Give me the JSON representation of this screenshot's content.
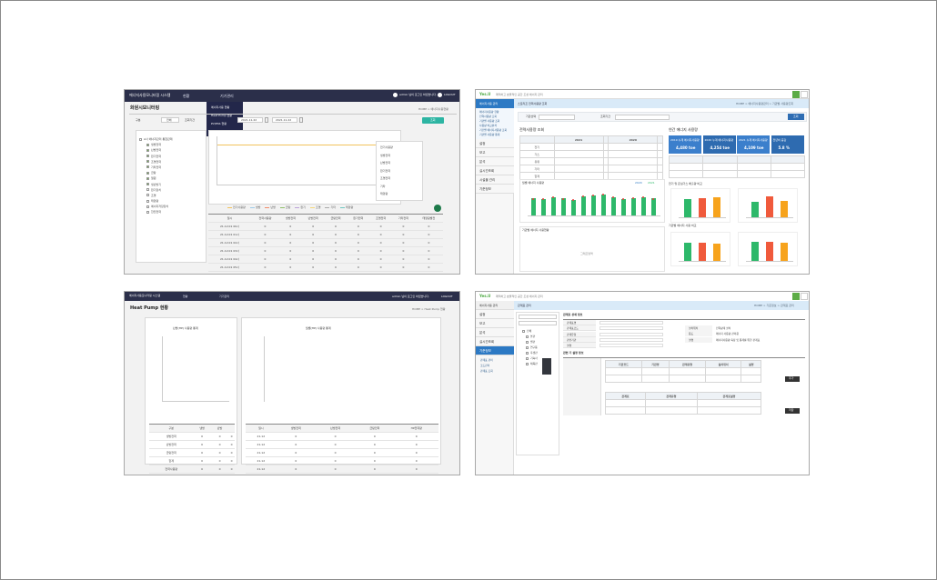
{
  "s1": {
    "app_title": "에너지사용모니터링 시스템",
    "nav": [
      "현황",
      "기기관리"
    ],
    "user": "admin 님이 로그인 하셨습니다.",
    "logout": "LOGOUT",
    "dropdown": [
      "에너지사용 현황",
      "Heat Pump 현황",
      "PV/ESS 현황",
      "에너지사용량 조회"
    ],
    "page_title": "화원시모니터링",
    "breadcrumb": "HOME > 에너지사용현황",
    "filter_label1": "구분",
    "filter_value1": "전체",
    "filter_label2": "조회기간",
    "date_from": "2021.11.22",
    "date_to": "2021.11.22",
    "search_btn": "조회",
    "tree": [
      "A사 에너지관리 통합관제",
      "냉방전력",
      "난방전력",
      "환기전력",
      "조명전력",
      "기타전력",
      "급탕",
      "열원",
      "냉난방기",
      "환기장치",
      "조명",
      "태양광",
      "에너지저장장치",
      "한전전력"
    ],
    "legend": [
      "전기사용량",
      "냉방",
      "난방",
      "급탕",
      "환기",
      "조명",
      "기타",
      "태양광"
    ],
    "side_list": [
      "전기사용량",
      "냉방전력",
      "난방전력",
      "환기전력",
      "조명전력",
      "기타",
      "태양광"
    ],
    "table_headers": [
      "일시",
      "전력사용량",
      "냉방전력",
      "난방전력",
      "급탕전력",
      "환기전력",
      "조명전력",
      "기타전력",
      "태양광발전"
    ],
    "table_rows": [
      [
        "21.12.01 00시",
        "0",
        "0",
        "0",
        "0",
        "0",
        "0",
        "0",
        "0"
      ],
      [
        "21.12.01 01시",
        "0",
        "0",
        "0",
        "0",
        "0",
        "0",
        "0",
        "0"
      ],
      [
        "21.12.01 02시",
        "0",
        "0",
        "0",
        "0",
        "0",
        "0",
        "0",
        "0"
      ],
      [
        "21.12.01 03시",
        "0",
        "0",
        "0",
        "0",
        "0",
        "0",
        "0",
        "0"
      ],
      [
        "21.12.01 04시",
        "0",
        "0",
        "0",
        "0",
        "0",
        "0",
        "0",
        "0"
      ],
      [
        "21.12.01 05시",
        "0",
        "0",
        "0",
        "0",
        "0",
        "0",
        "0",
        "0"
      ]
    ]
  },
  "s2": {
    "logo": "Yes.U",
    "logo_sub": "쾌적하고 효율적인 공간 조성 에너지 관리",
    "page_title": "스토리프 전력사용량 조회",
    "breadcrumb": "HOME > 에너지사용량관리 > 기관별 사용량조회",
    "sidebar_head": "에너지사용 관리",
    "sidebar_sub": [
      "에너지사용량 현황",
      "전력사용량 조회",
      "기관별 사용량 조회",
      "사용량 비교분석",
      "기간별 에너지사용량 조회",
      "기관별 사용량 통계"
    ],
    "nav": [
      "설정",
      "보고",
      "분석",
      "실시간조회",
      "시설물 관리",
      "기준정보"
    ],
    "filter1": "기관선택",
    "filter2": "조회기간",
    "search_btn": "조회",
    "left_title": "전력사용량 조회",
    "right_title": "연간 에너지 사용량",
    "blue_boxes": [
      {
        "label": "2019 누계 에너지사용량",
        "value": "4,480 toe"
      },
      {
        "label": "2020 누계 에너지사용량",
        "value": "4,254 toe"
      },
      {
        "label": "2021 누계 에너지사용량",
        "value": "4,109 toe"
      },
      {
        "label": "전년비 증감",
        "value": "5.8 %"
      }
    ],
    "chart1_title": "월별 에너지 사용량",
    "chart1_legend": [
      "2020",
      "2021"
    ],
    "chart1_values": [
      62,
      60,
      66,
      62,
      58,
      70,
      74,
      78,
      66,
      60,
      64,
      68,
      62
    ],
    "chart2_title": "기관별 에너지 사용현황",
    "chart2_placeholder": "그래프영역",
    "mini1_title": "전기 및 온실가스 배출량 비교",
    "mini2_title": "기관별 에너지 사용 비교",
    "mini_values": [
      [
        70,
        75,
        78
      ],
      [
        60,
        82,
        64
      ],
      [
        72,
        70,
        68
      ],
      [
        74,
        76,
        72
      ]
    ],
    "mini_colors": [
      "#2db86a",
      "#f05a3c",
      "#f7a31c"
    ]
  },
  "s3": {
    "app_title": "에너지사용모니터링 시스템",
    "nav": [
      "현황",
      "기기관리"
    ],
    "user": "admin 님이 로그인 하셨습니다.",
    "logout": "LOGOUT",
    "page_title": "Heat Pump 현황",
    "breadcrumb": "HOME > Heat Pump 현황",
    "left_chart_title": "난방(HP) 사용량 통계",
    "right_chart_title": "월별(HP) 사용량 통계",
    "left_table_headers": [
      "구분",
      "냉방",
      "난방"
    ],
    "left_table_rows": [
      [
        "냉방전력",
        "0",
        "0",
        "0"
      ],
      [
        "난방전력",
        "0",
        "0",
        "0"
      ],
      [
        "급탕전력",
        "0",
        "0",
        "0"
      ],
      [
        "합계",
        "0",
        "0",
        "0"
      ],
      [
        "전력사용량",
        "0",
        "0",
        "0"
      ]
    ],
    "right_table_headers": [
      "일시",
      "냉방전력",
      "난방전력",
      "급탕전력",
      "HP전력량"
    ],
    "right_table_rows": [
      [
        "21.12",
        "0",
        "0",
        "0",
        "0"
      ],
      [
        "21.12",
        "0",
        "0",
        "0",
        "0"
      ],
      [
        "21.12",
        "0",
        "0",
        "0",
        "0"
      ],
      [
        "21.12",
        "0",
        "0",
        "0",
        "0"
      ],
      [
        "21.12",
        "0",
        "0",
        "0",
        "0"
      ]
    ]
  },
  "s4": {
    "logo": "Yes.U",
    "logo_sub": "쾌적하고 효율적인 공간 조성 에너지 관리",
    "page_title": "관계표 관리",
    "breadcrumb": "HOME > 기준정보 > 관계표 관리",
    "sidebar_head": "에너지사용 관리",
    "nav": [
      "설정",
      "보고",
      "분석",
      "실시간조회",
      "기준정보"
    ],
    "nav_sub": [
      "관계표 관리",
      "코드관리",
      "관계표 조회"
    ],
    "section1": "관계표 상세 정보",
    "section2": "관련 기 설정 정보",
    "form_labels": [
      "관계표명",
      "관계표코드",
      "관계유형",
      "관련기관",
      "설명"
    ],
    "form_right_labels": [
      "설치위치",
      "용도",
      "설명"
    ],
    "form_right_values": [
      "전력량계 설치",
      "에너지 사용량 관리용",
      "에너지사용량 측정 및 통계를 위한 관계표"
    ],
    "grid1_headers": [
      "기관코드",
      "기관명",
      "관계유형",
      "설치위치",
      "설명"
    ],
    "grid2_headers": [
      "관계표",
      "관계유형",
      "관계표설명"
    ],
    "btn_add": "추가",
    "btn_save": "저장",
    "tree_items": [
      "전체",
      "본관",
      "별관",
      "연구동",
      "후생관",
      "기숙사",
      "체육관"
    ]
  }
}
